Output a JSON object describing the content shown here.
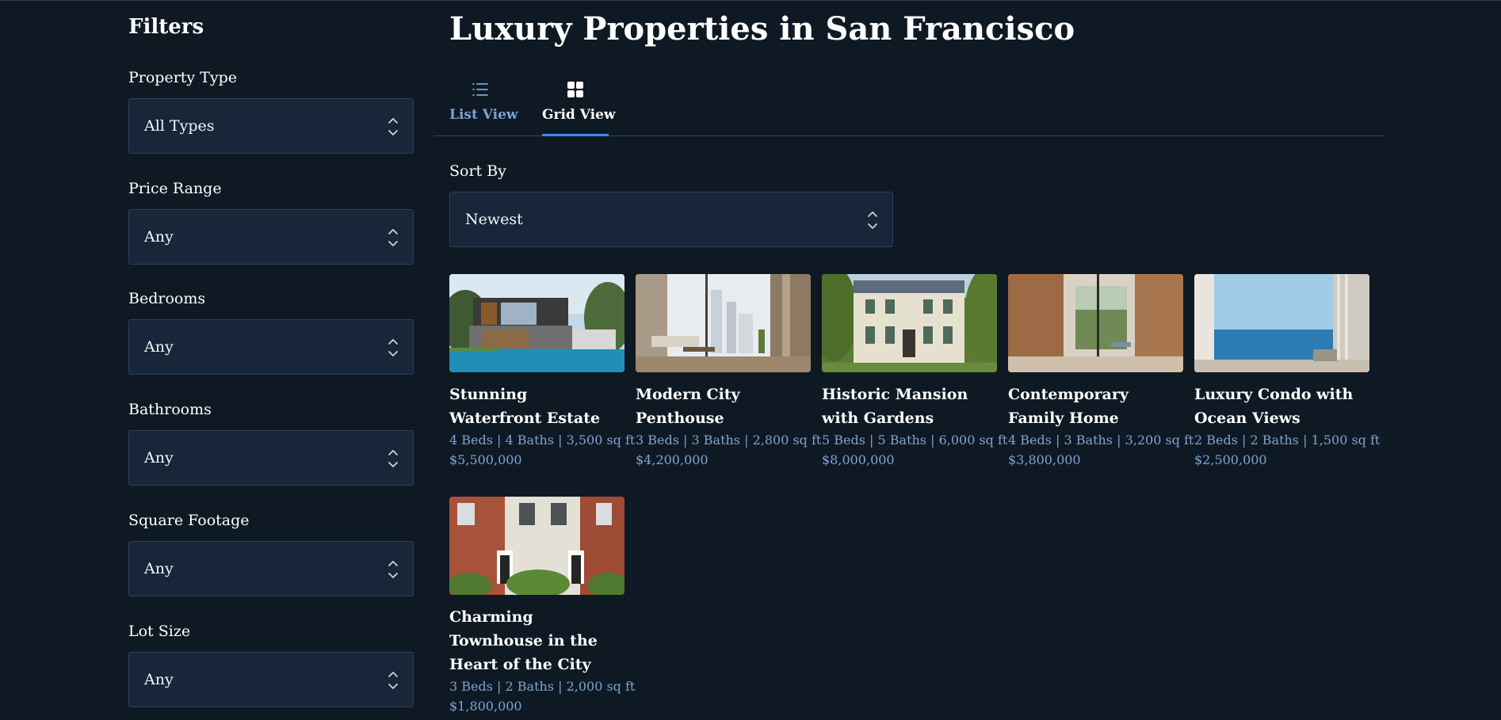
{
  "sidebar": {
    "title": "Filters",
    "filters": [
      {
        "label": "Property Type",
        "value": "All Types"
      },
      {
        "label": "Price Range",
        "value": "Any"
      },
      {
        "label": "Bedrooms",
        "value": "Any"
      },
      {
        "label": "Bathrooms",
        "value": "Any"
      },
      {
        "label": "Square Footage",
        "value": "Any"
      },
      {
        "label": "Lot Size",
        "value": "Any"
      }
    ]
  },
  "main": {
    "title": "Luxury Properties in San Francisco",
    "tabs": [
      {
        "label": "List View",
        "icon": "list-icon",
        "active": false
      },
      {
        "label": "Grid View",
        "icon": "grid-icon",
        "active": true
      }
    ],
    "sort": {
      "label": "Sort By",
      "value": "Newest"
    },
    "listings": [
      {
        "title": "Stunning Waterfront Estate",
        "specs": "4 Beds | 4 Baths | 3,500 sq ft",
        "price": "$5,500,000",
        "image": "modern-villa-pool-photo"
      },
      {
        "title": "Modern City Penthouse",
        "specs": "3 Beds | 3 Baths | 2,800 sq ft",
        "price": "$4,200,000",
        "image": "penthouse-interior-photo"
      },
      {
        "title": "Historic Mansion with Gardens",
        "specs": "5 Beds | 5 Baths | 6,000 sq ft",
        "price": "$8,000,000",
        "image": "historic-mansion-photo"
      },
      {
        "title": "Contemporary Family Home",
        "specs": "4 Beds | 3 Baths | 3,200 sq ft",
        "price": "$3,800,000",
        "image": "contemporary-interior-photo"
      },
      {
        "title": "Luxury Condo with Ocean Views",
        "specs": "2 Beds | 2 Baths | 1,500 sq ft",
        "price": "$2,500,000",
        "image": "ocean-view-condo-photo"
      },
      {
        "title": "Charming Townhouse in the Heart of the City",
        "specs": "3 Beds | 2 Baths | 2,000 sq ft",
        "price": "$1,800,000",
        "image": "brick-townhouse-photo"
      }
    ]
  },
  "colors": {
    "background": "#0f1924",
    "panel": "#172638",
    "border": "#2e4158",
    "accent": "#3b8be6",
    "muted_text": "#7ea3d0"
  }
}
